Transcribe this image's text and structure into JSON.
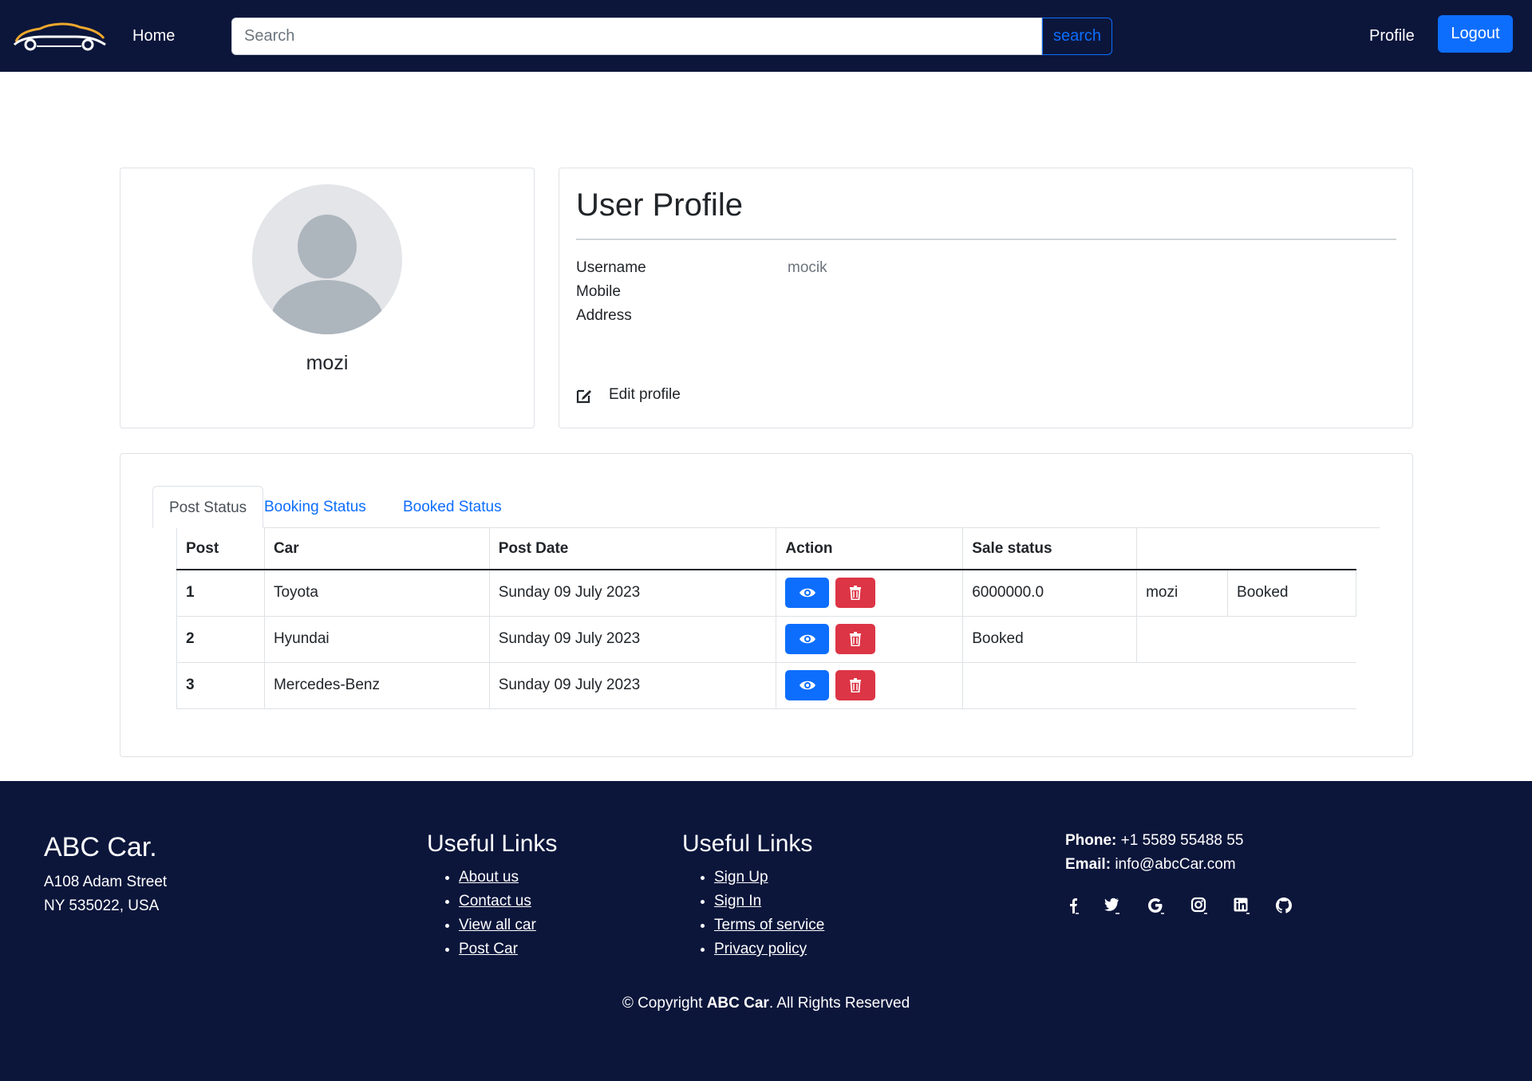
{
  "nav": {
    "home": "Home",
    "search_placeholder": "Search",
    "search_button": "search",
    "profile": "Profile",
    "logout": "Logout"
  },
  "profile_card": {
    "name": "mozi"
  },
  "user_profile": {
    "title": "User Profile",
    "fields": [
      {
        "label": "Username",
        "value": "mocik"
      },
      {
        "label": "Mobile",
        "value": ""
      },
      {
        "label": "Address",
        "value": ""
      }
    ],
    "edit_label": "Edit profile"
  },
  "tabs": [
    {
      "label": "Post Status",
      "active": true
    },
    {
      "label": "Booking Status",
      "active": false
    },
    {
      "label": "Booked Status",
      "active": false
    }
  ],
  "table": {
    "headers": [
      "Post",
      "Car",
      "Post Date",
      "Action",
      "Sale status"
    ],
    "rows": [
      {
        "post": "1",
        "car": "Toyota",
        "date": "Sunday 09 July 2023",
        "sale": "6000000.0",
        "extra1": "mozi",
        "extra2": "Booked"
      },
      {
        "post": "2",
        "car": "Hyundai",
        "date": "Sunday 09 July 2023",
        "sale": "Booked",
        "extra1": "",
        "extra2": ""
      },
      {
        "post": "3",
        "car": "Mercedes-Benz",
        "date": "Sunday 09 July 2023",
        "sale": "",
        "extra1": "",
        "extra2": ""
      }
    ]
  },
  "footer": {
    "brand": "ABC Car.",
    "address_line1": "A108 Adam Street",
    "address_line2": "NY 535022, USA",
    "links1": {
      "title": "Useful Links",
      "items": [
        "About us",
        "Contact us",
        "View all car",
        "Post Car"
      ]
    },
    "links2": {
      "title": "Useful Links",
      "items": [
        "Sign Up",
        "Sign In",
        "Terms of service",
        "Privacy policy"
      ]
    },
    "phone_label": "Phone:",
    "phone": "+1 5589 55488 55",
    "email_label": "Email:",
    "email": "info@abcCar.com",
    "social_icons": [
      "facebook-icon",
      "twitter-icon",
      "google-icon",
      "instagram-icon",
      "linkedin-icon",
      "github-icon"
    ],
    "copyright_prefix": "© Copyright ",
    "copyright_brand": "ABC Car",
    "copyright_suffix": ". All Rights Reserved"
  },
  "colors": {
    "navy": "#0c163b",
    "primary": "#0d6efd",
    "danger": "#dc3545"
  }
}
